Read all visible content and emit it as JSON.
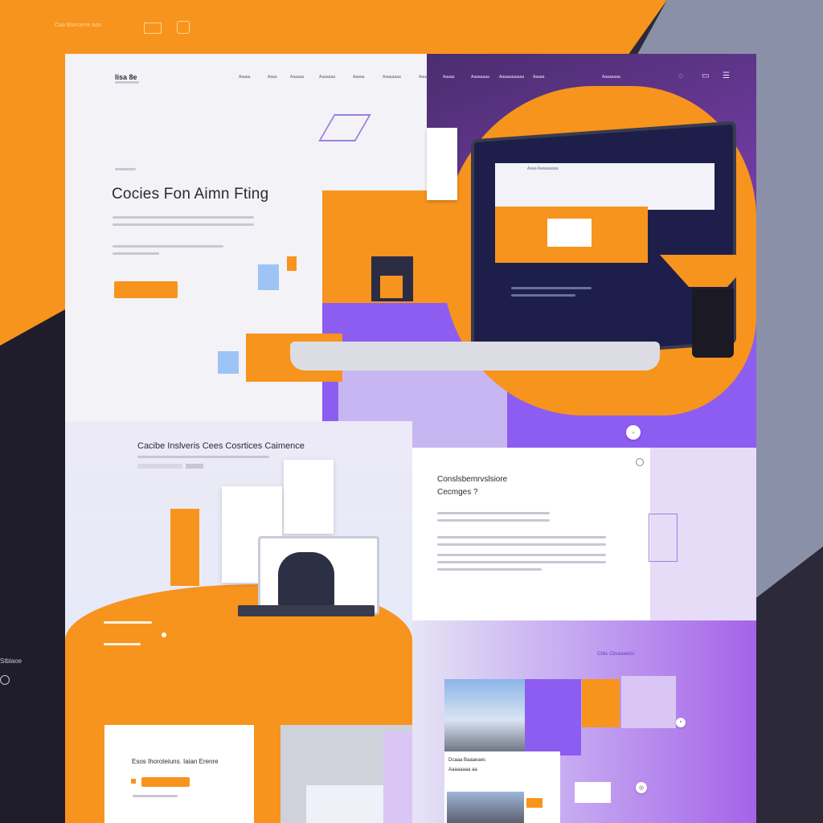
{
  "backdrop": {
    "brand": "Caa Bsecaree aaa",
    "side_label": "Stblaoe"
  },
  "header": {
    "logo": "lisa 8e",
    "nav": [
      "Aaaaa",
      "Aaaa",
      "Aaaaaa",
      "Aaaaaaa",
      "Aaaaa",
      "Aaaaaaaa",
      "Aaaa",
      "Aaaaa",
      "Aaaaaaaa",
      "Aaaaaaaaaaa",
      "Aaaaa",
      "Aaaaaaaa"
    ]
  },
  "hero": {
    "title": "Cocies Fon Aimn Fting"
  },
  "screen": {
    "header_label": "Aaaa Aaaaaaaaa"
  },
  "features": {
    "title": "Cacibe Inslveris Cees Cosrtices Caimence"
  },
  "info": {
    "title_line1": "Conslsbemrvslsiore",
    "title_line2": "Cecmges ?"
  },
  "gallery": {
    "label": "Cbiis Cbsaaeeics",
    "card_title": "Dcaaa Baaaeaes",
    "card_sub": "Aaaaaaaa aa"
  },
  "cta": {
    "title": "Esos Ihoroteiuns. Iaian Erenre"
  },
  "colors": {
    "accent_orange": "#f7941d",
    "accent_purple": "#8d5cf0",
    "dark": "#1f1d2c"
  }
}
